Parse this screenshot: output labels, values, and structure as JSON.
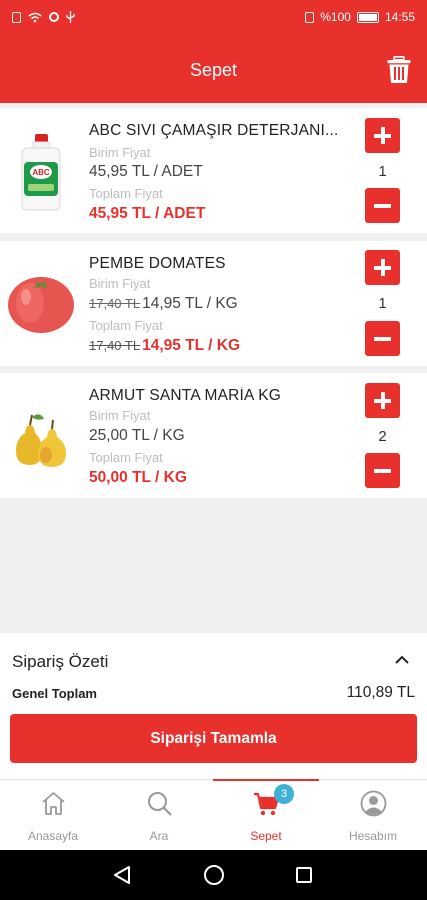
{
  "status_bar": {
    "battery": "%100",
    "time": "14:55"
  },
  "app_bar": {
    "title": "Sepet",
    "trash_icon": "trash-icon"
  },
  "cart_items": [
    {
      "name": "ABC SIVI ÇAMAŞIR DETERJANI...",
      "unit_label": "Birim Fiyat",
      "unit_price": "45,95 TL / ADET",
      "unit_old_price": "",
      "total_label": "Toplam Fiyat",
      "total_price": "45,95 TL / ADET",
      "total_old_price": "",
      "quantity": "1"
    },
    {
      "name": "PEMBE DOMATES",
      "unit_label": "Birim Fiyat",
      "unit_price": "14,95 TL / KG",
      "unit_old_price": "17,40 TL",
      "total_label": "Toplam Fiyat",
      "total_price": "14,95 TL / KG",
      "total_old_price": "17,40 TL",
      "quantity": "1"
    },
    {
      "name": "ARMUT SANTA MARİA KG",
      "unit_label": "Birim Fiyat",
      "unit_price": "25,00 TL / KG",
      "unit_old_price": "",
      "total_label": "Toplam Fiyat",
      "total_price": "50,00 TL / KG",
      "total_old_price": "",
      "quantity": "2"
    }
  ],
  "summary": {
    "title": "Sipariş Özeti",
    "grand_total_label": "Genel Toplam",
    "grand_total_value": "110,89 TL",
    "complete_button": "Siparişi Tamamla"
  },
  "tabs": [
    {
      "label": "Anasayfa",
      "icon": "home-icon"
    },
    {
      "label": "Ara",
      "icon": "search-icon"
    },
    {
      "label": "Sepet",
      "icon": "cart-icon",
      "badge": "3",
      "active": true
    },
    {
      "label": "Hesabım",
      "icon": "account-icon"
    }
  ],
  "colors": {
    "brand": "#e8312c",
    "badge": "#3fb0d8"
  }
}
